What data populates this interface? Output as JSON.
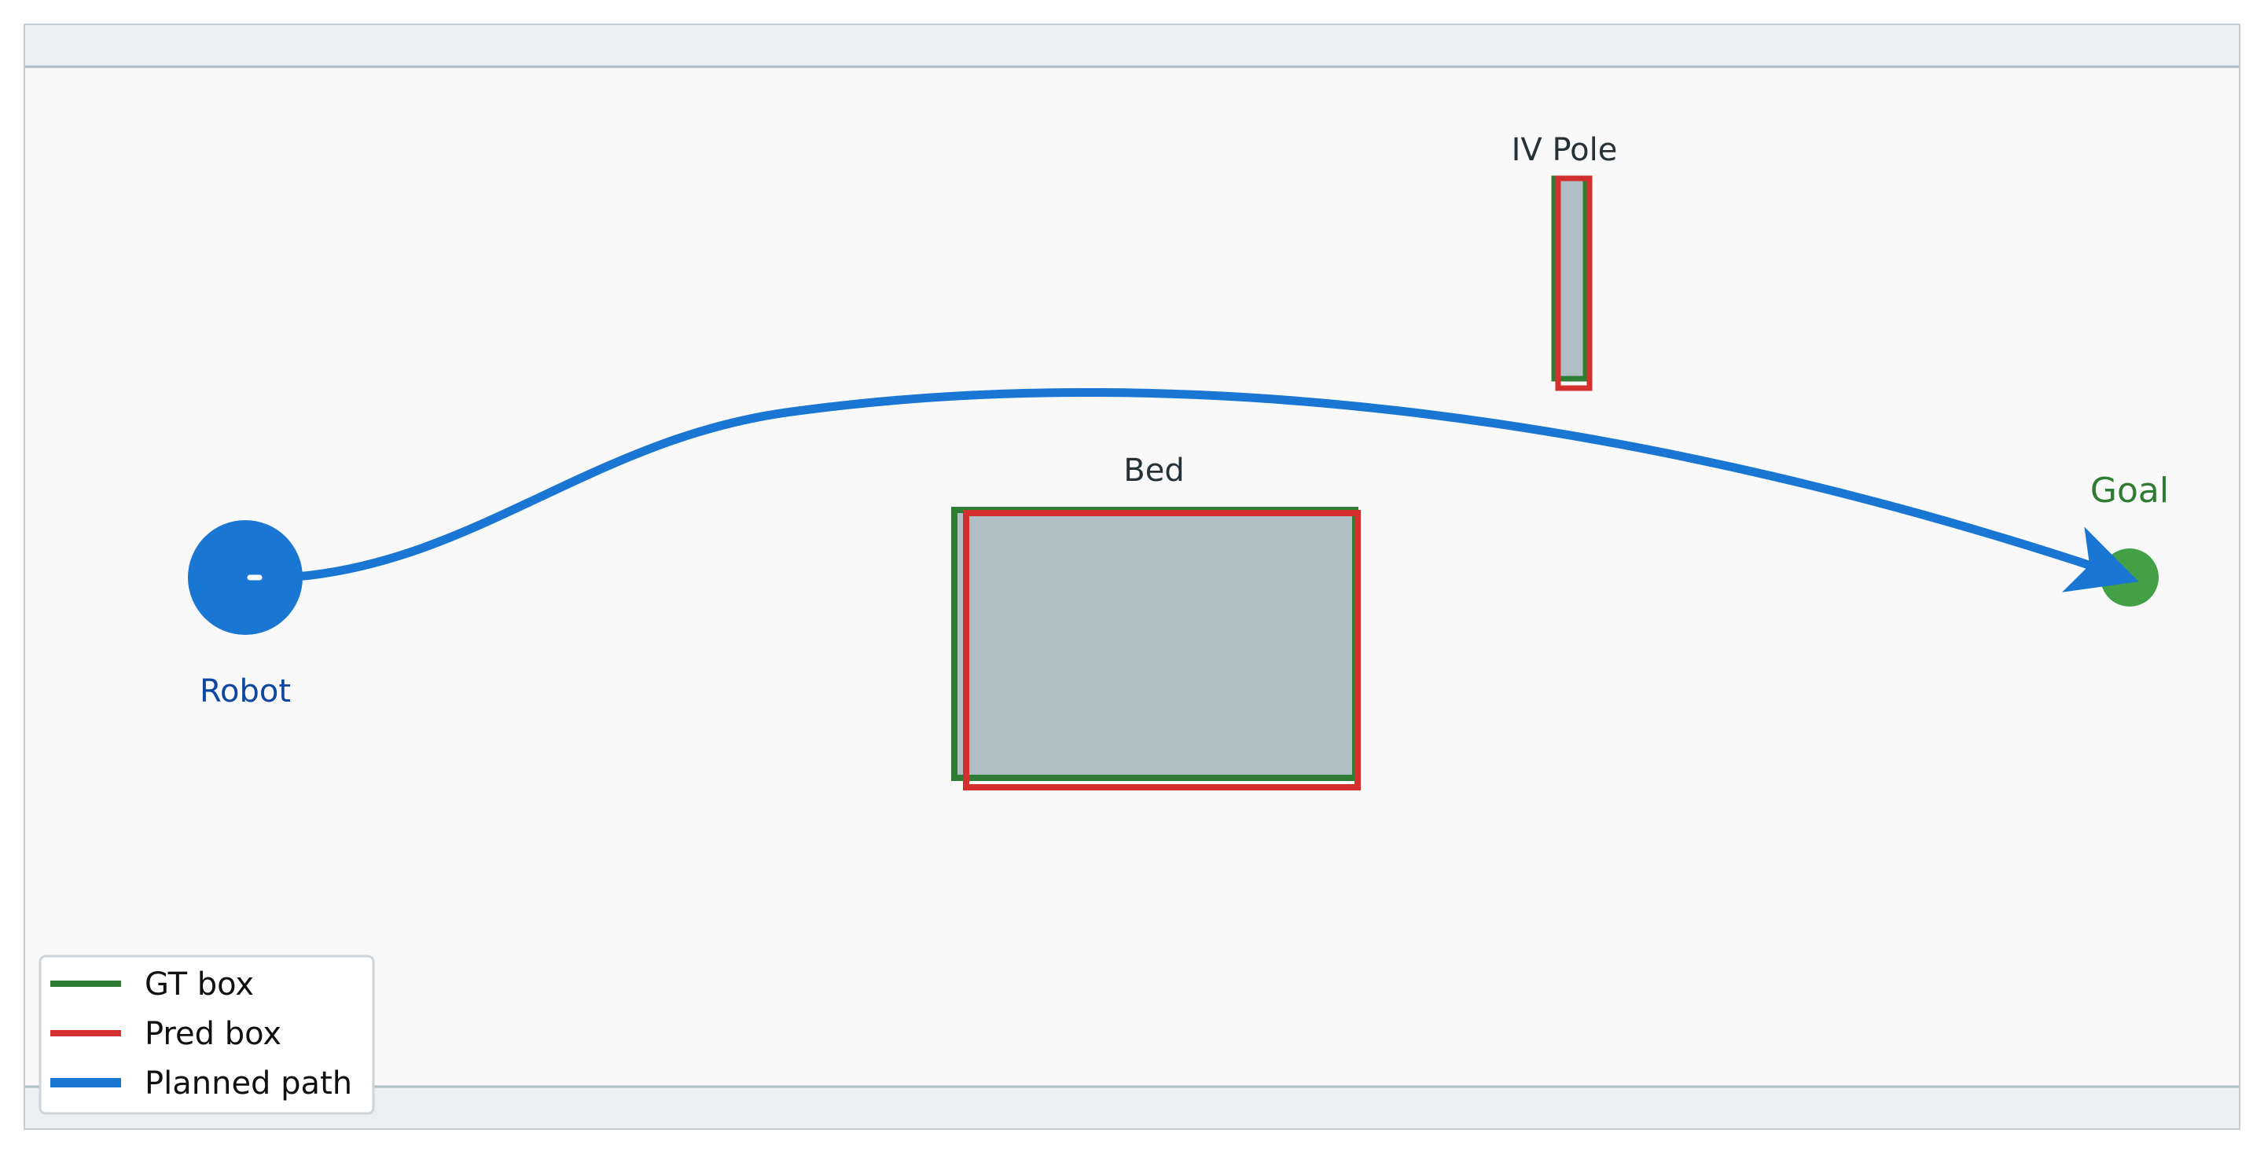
{
  "scene": {
    "colors": {
      "room_floor": "#f9f9f9",
      "wall_band": "#eceff1",
      "wall_line": "#b0bec5",
      "obstacle_fill": "#b0bec5",
      "gt_box": "#2e7d32",
      "pred_box": "#d32f2f",
      "path": "#1976d2",
      "robot": "#1976d2",
      "robot_label": "#0d47a1",
      "goal": "#43a047",
      "goal_label": "#2e7d32",
      "text": "#263238"
    },
    "objects": [
      {
        "id": "bed",
        "label": "Bed"
      },
      {
        "id": "iv_pole",
        "label": "IV Pole"
      }
    ],
    "robot": {
      "label": "Robot",
      "icon": "robot-disc"
    },
    "goal": {
      "label": "Goal",
      "icon": "goal-dot"
    }
  },
  "legend": {
    "items": [
      {
        "label": "GT box",
        "color": "#2e7d32"
      },
      {
        "label": "Pred box",
        "color": "#d32f2f"
      },
      {
        "label": "Planned path",
        "color": "#1976d2"
      }
    ]
  }
}
